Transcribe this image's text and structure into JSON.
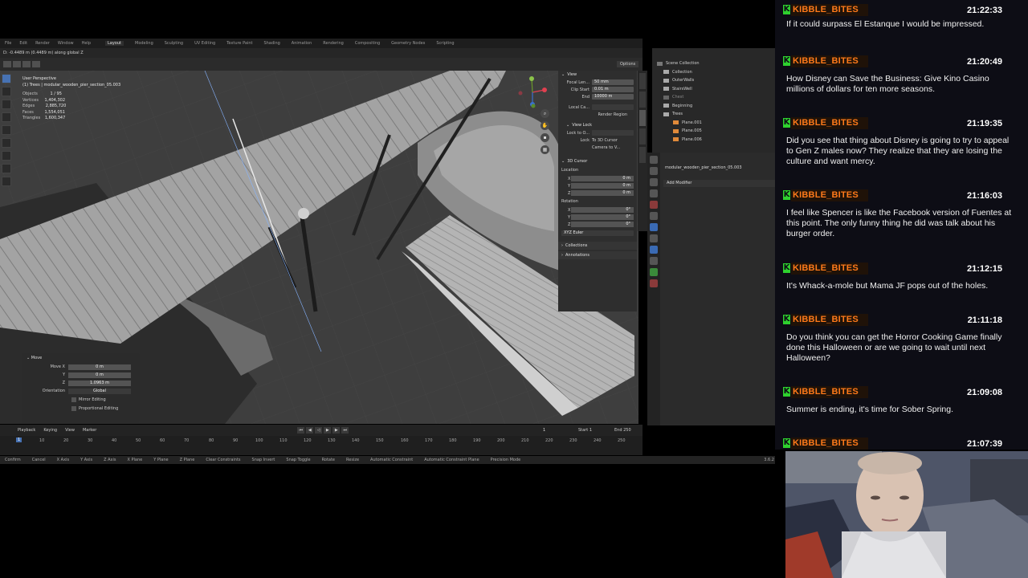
{
  "blender": {
    "topbar": {
      "menus": [
        "File",
        "Edit",
        "Render",
        "Window",
        "Help"
      ],
      "workspaces": [
        "Layout",
        "Modeling",
        "Sculpting",
        "UV Editing",
        "Texture Paint",
        "Shading",
        "Animation",
        "Rendering",
        "Compositing",
        "Geometry Nodes",
        "Scripting"
      ],
      "active_workspace": "Layout"
    },
    "header_status": "D: -0.4489 m (0.4489 m) along global Z",
    "options_label": "Options",
    "viewport": {
      "perspective": "User Perspective",
      "object_name": "(1) Trees | modular_wooden_pier_section_05.003",
      "stats": [
        {
          "label": "Objects",
          "value": "1 / 95"
        },
        {
          "label": "Vertices",
          "value": "1,404,302"
        },
        {
          "label": "Edges",
          "value": "2,885,720"
        },
        {
          "label": "Faces",
          "value": "1,554,051"
        },
        {
          "label": "Triangles",
          "value": "1,600,347"
        }
      ]
    },
    "npanel": {
      "view_title": "View",
      "focal_label": "Focal Len...",
      "focal_value": "50 mm",
      "clip_start_label": "Clip Start",
      "clip_start_value": "0.01 m",
      "clip_end_label": "End",
      "clip_end_value": "10000 m",
      "local_camera_label": "Local Ca...",
      "render_region_label": "Render Region",
      "view_lock_title": "View Lock",
      "lock_to_label": "Lock to O...",
      "lock_label": "Lock",
      "to_3d_cursor": "To 3D Cursor",
      "camera_to_view": "Camera to V...",
      "cursor_title": "3D Cursor",
      "location_label": "Location",
      "loc": [
        {
          "axis": "X",
          "value": "0 m"
        },
        {
          "axis": "Y",
          "value": "0 m"
        },
        {
          "axis": "Z",
          "value": "0 m"
        }
      ],
      "rotation_label": "Rotation",
      "rot": [
        {
          "axis": "X",
          "value": "0°"
        },
        {
          "axis": "Y",
          "value": "0°"
        },
        {
          "axis": "Z",
          "value": "0°"
        }
      ],
      "rotation_mode": "XYZ Euler",
      "collections_label": "Collections",
      "annotations_label": "Annotations"
    },
    "operator": {
      "title": "Move",
      "move_x_label": "Move X",
      "move_x": "0 m",
      "y_label": "Y",
      "y": "0 m",
      "z_label": "Z",
      "z": "1.0963 m",
      "orientation_label": "Orientation",
      "orientation": "Global",
      "mirror_editing": "Mirror Editing",
      "proportional_editing": "Proportional Editing"
    },
    "timeline": {
      "menus": [
        "Playback",
        "Keying",
        "View",
        "Marker"
      ],
      "current_frame": "1",
      "start_label": "Start",
      "start": "1",
      "end_label": "End",
      "end": "250",
      "ticks": [
        "0",
        "10",
        "20",
        "30",
        "40",
        "50",
        "60",
        "70",
        "80",
        "90",
        "100",
        "110",
        "120",
        "130",
        "140",
        "150",
        "160",
        "170",
        "180",
        "190",
        "200",
        "210",
        "220",
        "230",
        "240",
        "250"
      ],
      "playhead": "1"
    },
    "statusbar": {
      "items": [
        "Confirm",
        "Cancel",
        "X Axis",
        "Y Axis",
        "Z Axis",
        "X Plane",
        "Y Plane",
        "Z Plane",
        "Clear Constraints",
        "Snap Invert",
        "Snap Toggle",
        "Rotate",
        "Resize",
        "Automatic Constraint",
        "Automatic Constraint Plane",
        "Precision Mode"
      ],
      "version": "3.6.2"
    },
    "outliner": {
      "scene_collection": "Scene Collection",
      "items": [
        "Collection",
        "OuterWalls",
        "StairsWell",
        "Chest",
        "Beginning",
        "Trees",
        "Plane.001",
        "Plane.005",
        "Plane.006"
      ]
    },
    "properties": {
      "object_name": "modular_wooden_pier_section_05.003",
      "add_modifier": "Add Modifier"
    }
  },
  "chat": {
    "messages": [
      {
        "user": "KIBBLE_BITES",
        "time": "21:22:33",
        "text": "If it could surpass El Estanque I would be impressed."
      },
      {
        "user": "KIBBLE_BITES",
        "time": "21:20:49",
        "text": "How Disney can Save the Business: Give Kino Casino millions of dollars for ten more seasons."
      },
      {
        "user": "KIBBLE_BITES",
        "time": "21:19:35",
        "text": "Did you see that thing about Disney is going to try to appeal to Gen Z males now? They realize that they are losing the culture and want mercy."
      },
      {
        "user": "KIBBLE_BITES",
        "time": "21:16:03",
        "text": "I feel like Spencer is like the Facebook version of Fuentes at this point. The only funny thing he did was talk about his burger order."
      },
      {
        "user": "KIBBLE_BITES",
        "time": "21:12:15",
        "text": "It's Whack-a-mole but Mama JF pops out of the holes."
      },
      {
        "user": "KIBBLE_BITES",
        "time": "21:11:18",
        "text": "Do you think you can get the Horror Cooking Game finally done this Halloween or are we going to wait until next Halloween?"
      },
      {
        "user": "KIBBLE_BITES",
        "time": "21:09:08",
        "text": "Summer is ending, it's time for Sober Spring."
      },
      {
        "user": "KIBBLE_BITES",
        "time": "21:07:39",
        "text": ""
      }
    ],
    "badge": "K"
  }
}
